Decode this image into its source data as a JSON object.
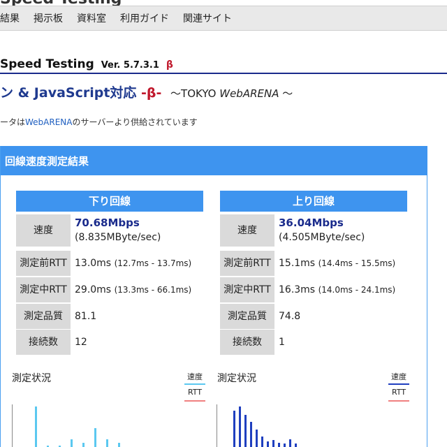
{
  "header": {
    "top_text": "Speed Testing"
  },
  "nav": {
    "items": [
      "結果",
      "掲示板",
      "資料室",
      "利用ガイド",
      "関連サイト"
    ]
  },
  "app": {
    "title": "Speed Testing",
    "version": "Ver. 5.7.3.1",
    "beta": "β"
  },
  "subtitle": {
    "main": "ン & JavaScript対応",
    "beta": "-β-",
    "tokyo_prefix": "～TOKYO ",
    "tokyo_arena": "WebARENA",
    "tokyo_suffix": " ～"
  },
  "notice": {
    "prefix": "ータは",
    "link": "WebARENA",
    "suffix": "のサーバーより供給されています"
  },
  "panel": {
    "title": "回線速度測定結果"
  },
  "download": {
    "header": "下り回線",
    "rows": [
      {
        "label": "速度",
        "main": "70.68Mbps",
        "sub": "(8.835MByte/sec)"
      },
      {
        "label": "測定前RTT",
        "main": "13.0ms",
        "range": "(12.7ms - 13.7ms)"
      },
      {
        "label": "測定中RTT",
        "main": "29.0ms",
        "range": "(13.3ms - 66.1ms)"
      },
      {
        "label": "測定品質",
        "main": "81.1"
      },
      {
        "label": "接続数",
        "main": "12"
      }
    ]
  },
  "upload": {
    "header": "上り回線",
    "rows": [
      {
        "label": "速度",
        "main": "36.04Mbps",
        "sub": "(4.505MByte/sec)"
      },
      {
        "label": "測定前RTT",
        "main": "15.1ms",
        "range": "(14.4ms - 15.5ms)"
      },
      {
        "label": "測定中RTT",
        "main": "16.3ms",
        "range": "(14.0ms - 24.1ms)"
      },
      {
        "label": "測定品質",
        "main": "74.8"
      },
      {
        "label": "接続数",
        "main": "1"
      }
    ]
  },
  "status_left": {
    "title": "測定状況",
    "legend_speed": "速度",
    "legend_rtt": "RTT"
  },
  "status_right": {
    "title": "測定状況",
    "legend_speed": "速度",
    "legend_rtt": "RTT"
  },
  "colors": {
    "accent": "#3e94ef",
    "navy": "#1a2b8c",
    "beta_red": "#c0182c",
    "down_speed": "#5bc8f0",
    "up_speed": "#1f3fbf",
    "rtt": "#f08080"
  },
  "bars_left": [
    0.95,
    0.05,
    0.05,
    0.2,
    0.12,
    0.45,
    0.2,
    0.12
  ],
  "bars_right": [
    0.85,
    0.95,
    0.75,
    0.6,
    0.42,
    0.25,
    0.15,
    0.18,
    0.12,
    0.1,
    0.2,
    0.1
  ]
}
